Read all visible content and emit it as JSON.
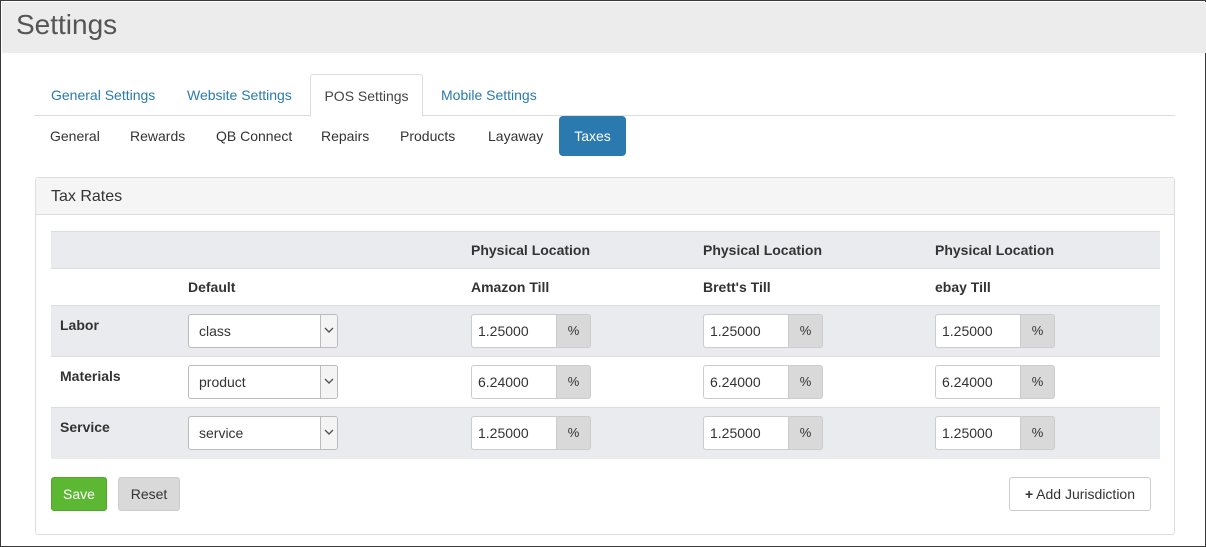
{
  "page": {
    "title": "Settings"
  },
  "main_tabs": [
    {
      "label": "General Settings"
    },
    {
      "label": "Website Settings"
    },
    {
      "label": "POS Settings",
      "active": true
    },
    {
      "label": "Mobile Settings"
    }
  ],
  "sub_tabs": [
    {
      "label": "General"
    },
    {
      "label": "Rewards"
    },
    {
      "label": "QB Connect"
    },
    {
      "label": "Repairs"
    },
    {
      "label": "Products"
    },
    {
      "label": "Layaway"
    },
    {
      "label": "Taxes",
      "active": true
    }
  ],
  "panel": {
    "title": "Tax Rates",
    "columns": [
      {
        "group": "",
        "label": "Default"
      },
      {
        "group": "Physical Location",
        "label": "Amazon Till"
      },
      {
        "group": "Physical Location",
        "label": "Brett's Till"
      },
      {
        "group": "Physical Location",
        "label": "ebay Till"
      }
    ],
    "rows": [
      {
        "label": "Labor",
        "default": "class",
        "rates": [
          "1.25000",
          "1.25000",
          "1.25000"
        ]
      },
      {
        "label": "Materials",
        "default": "product",
        "rates": [
          "6.24000",
          "6.24000",
          "6.24000"
        ]
      },
      {
        "label": "Service",
        "default": "service",
        "rates": [
          "1.25000",
          "1.25000",
          "1.25000"
        ]
      }
    ],
    "percent_symbol": "%",
    "buttons": {
      "save": "Save",
      "reset": "Reset",
      "add": "Add Jurisdiction",
      "add_icon": "plus-icon"
    }
  },
  "colors": {
    "accent": "#2a7ab0",
    "save": "#5cb833",
    "header_bg": "#ececec"
  }
}
